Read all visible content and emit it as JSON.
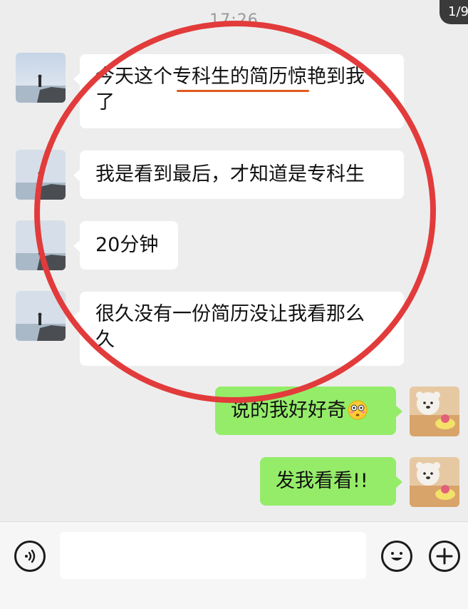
{
  "status": {
    "time": "17:26",
    "page_indicator": "1/9"
  },
  "messages": [
    {
      "side": "left",
      "text_line1": "今天这个专科生的简历惊艳到我",
      "text_line2": "了"
    },
    {
      "side": "left",
      "text": "我是看到最后，才知道是专科生"
    },
    {
      "side": "left",
      "text": "20分钟"
    },
    {
      "side": "left",
      "text_line1": "很久没有一份简历没让我看那么",
      "text_line2": "久"
    },
    {
      "side": "right",
      "text": "说的我好好奇",
      "emoji": "flushed-face"
    },
    {
      "side": "right",
      "text": "发我看看!!"
    }
  ],
  "input_bar": {
    "voice_icon": "voice-icon",
    "emoji_icon": "smile-icon",
    "add_icon": "plus-icon",
    "input_value": ""
  },
  "colors": {
    "background": "#ededed",
    "incoming_bubble": "#ffffff",
    "outgoing_bubble": "#95ec69",
    "annotation_circle": "#e23b3b",
    "underline": "#e05a1c"
  }
}
